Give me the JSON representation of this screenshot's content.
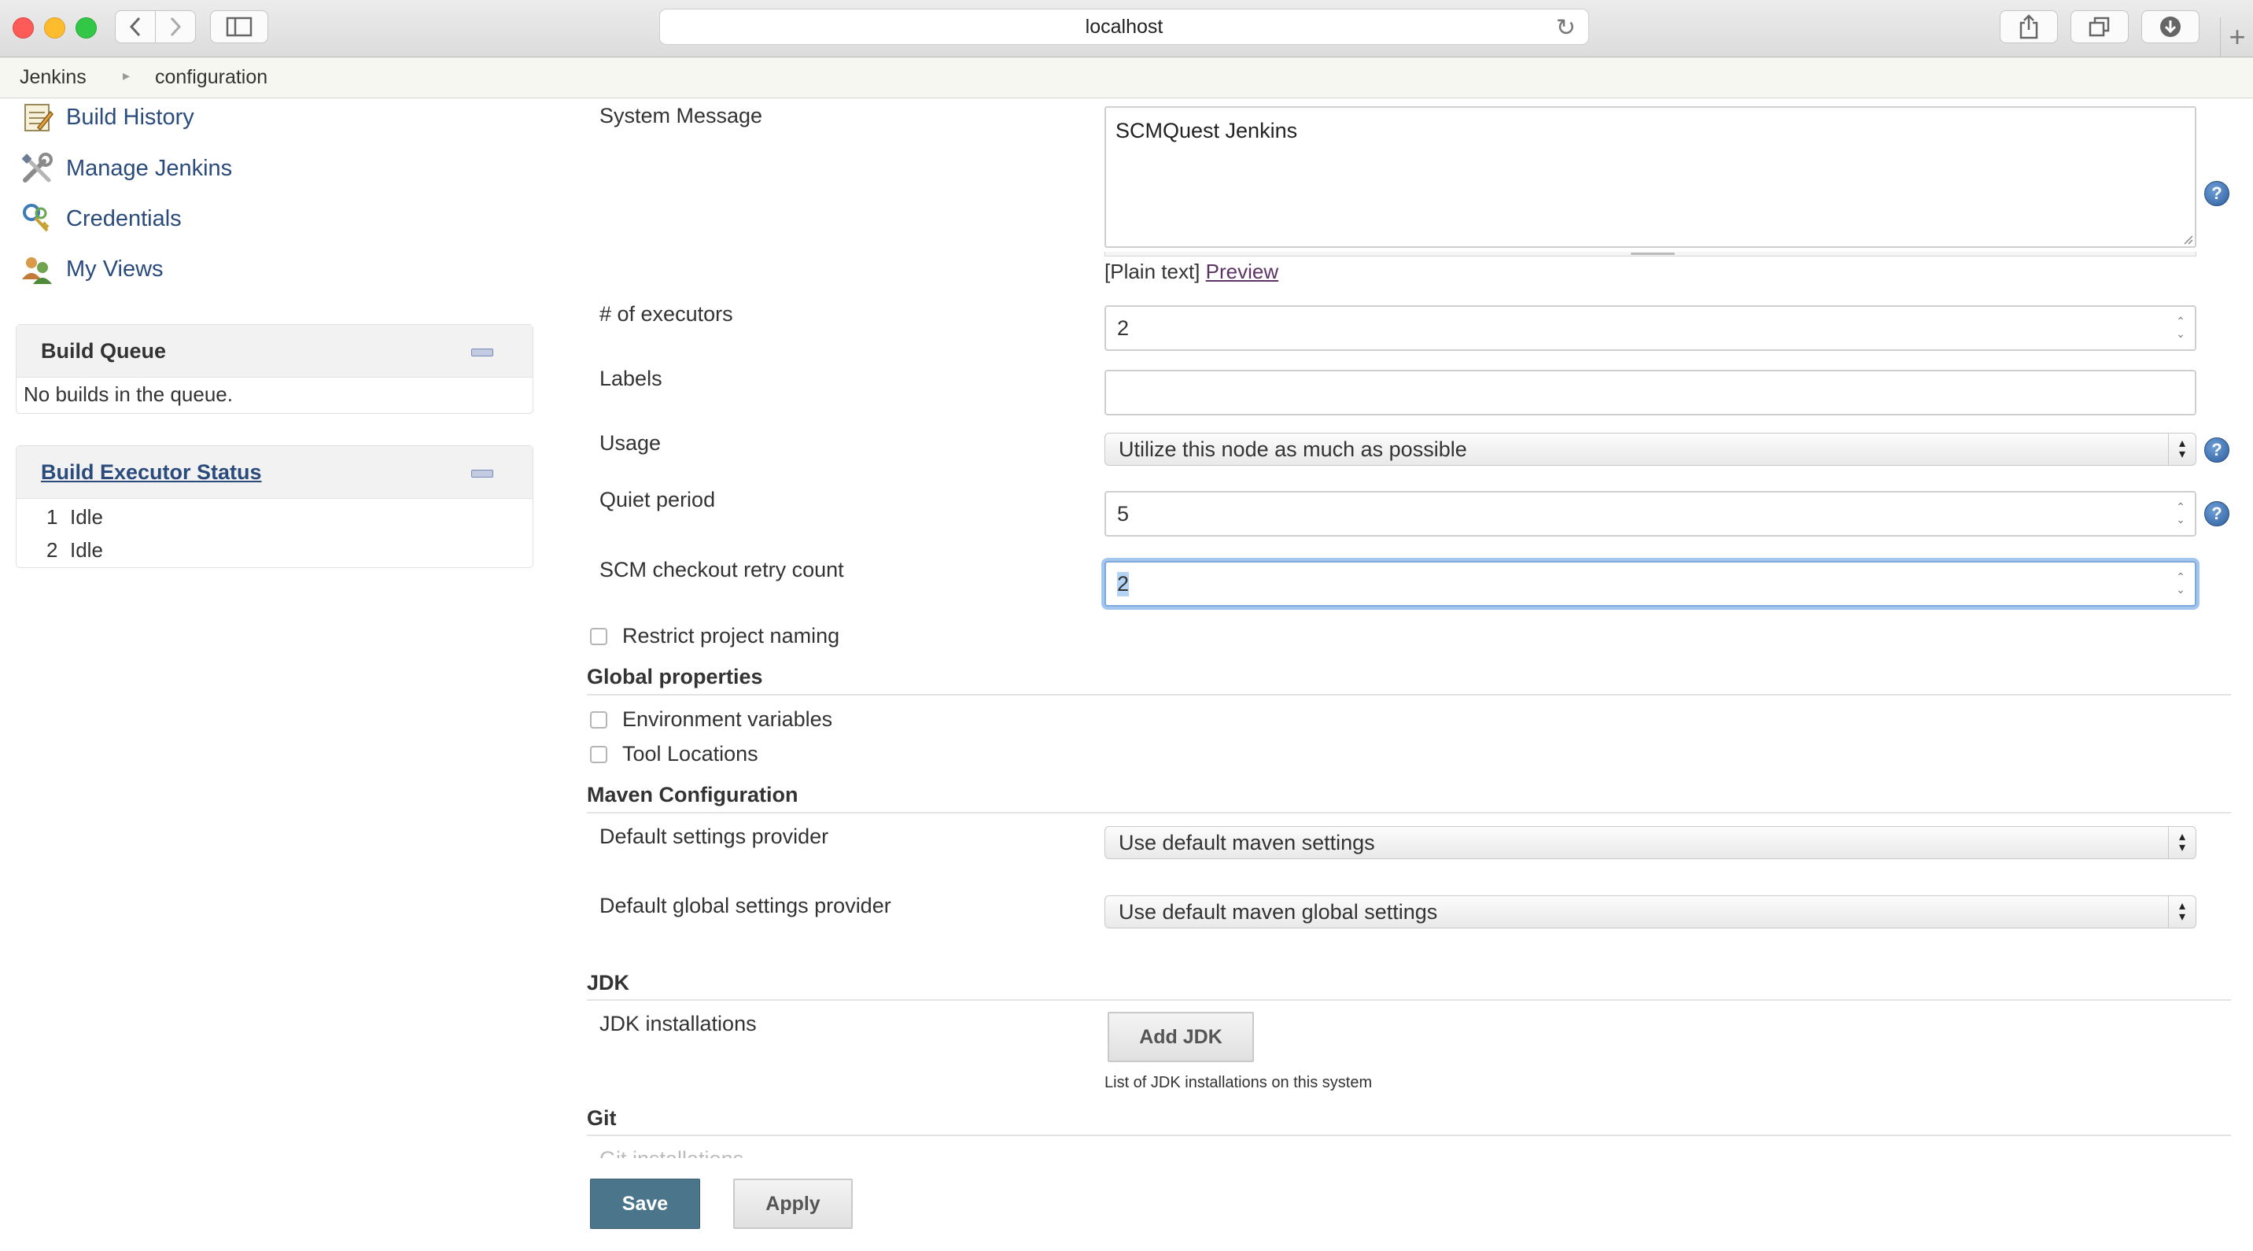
{
  "browser": {
    "url": "localhost"
  },
  "breadcrumb": {
    "root": "Jenkins",
    "current": "configuration"
  },
  "sidebar": {
    "tasks": [
      {
        "label": "Build History",
        "icon": "notepad-icon"
      },
      {
        "label": "Manage Jenkins",
        "icon": "tools-icon"
      },
      {
        "label": "Credentials",
        "icon": "keys-icon"
      },
      {
        "label": "My Views",
        "icon": "users-icon"
      }
    ],
    "build_queue": {
      "title": "Build Queue",
      "empty_text": "No builds in the queue."
    },
    "executor_status": {
      "title": "Build Executor Status",
      "executors": [
        {
          "number": "1",
          "state": "Idle"
        },
        {
          "number": "2",
          "state": "Idle"
        }
      ]
    }
  },
  "form": {
    "system_message": {
      "label": "System Message",
      "value": "SCMQuest Jenkins",
      "format_text": "[Plain text]",
      "preview_link": "Preview"
    },
    "executors": {
      "label": "# of executors",
      "value": "2"
    },
    "labels": {
      "label": "Labels",
      "value": ""
    },
    "usage": {
      "label": "Usage",
      "value": "Utilize this node as much as possible"
    },
    "quiet_period": {
      "label": "Quiet period",
      "value": "5"
    },
    "scm_retry": {
      "label": "SCM checkout retry count",
      "value": "2"
    },
    "restrict_naming": {
      "label": "Restrict project naming",
      "checked": false
    },
    "global_properties": {
      "title": "Global properties",
      "env_vars": {
        "label": "Environment variables",
        "checked": false
      },
      "tool_locations": {
        "label": "Tool Locations",
        "checked": false
      }
    },
    "maven": {
      "title": "Maven Configuration",
      "settings_provider": {
        "label": "Default settings provider",
        "value": "Use default maven settings"
      },
      "global_settings_provider": {
        "label": "Default global settings provider",
        "value": "Use default maven global settings"
      }
    },
    "jdk": {
      "title": "JDK",
      "installations_label": "JDK installations",
      "add_button": "Add JDK",
      "description": "List of JDK installations on this system"
    },
    "git": {
      "title": "Git",
      "installations_label": "Git installations"
    }
  },
  "actions": {
    "save": "Save",
    "apply": "Apply"
  },
  "colors": {
    "link": "#2a4b7c",
    "save_button": "#4b758b",
    "help_icon": "#2d5f9e",
    "focus_ring": "#a3c6ef"
  }
}
